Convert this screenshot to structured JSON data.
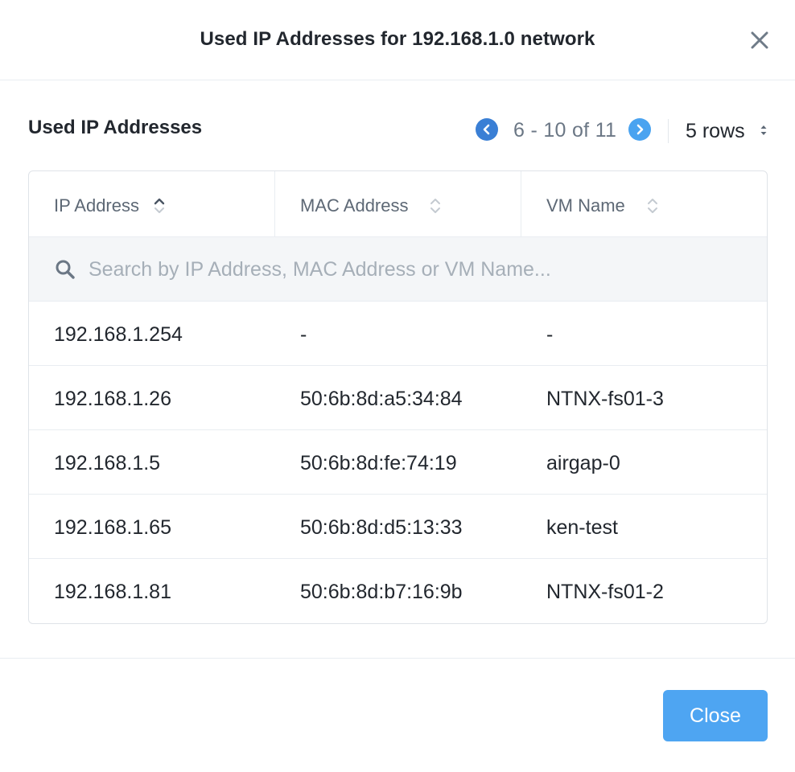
{
  "dialog": {
    "title": "Used IP Addresses for 192.168.1.0 network"
  },
  "section": {
    "title": "Used IP Addresses"
  },
  "pager": {
    "range": "6 - 10 of 11",
    "rows_label": "5 rows"
  },
  "table": {
    "columns": [
      "IP Address",
      "MAC Address",
      "VM Name"
    ],
    "sort": {
      "column": "IP Address",
      "direction": "ascending"
    },
    "search_placeholder": "Search by IP Address, MAC Address or VM Name...",
    "rows": [
      [
        "192.168.1.254",
        "-",
        "-"
      ],
      [
        "192.168.1.26",
        "50:6b:8d:a5:34:84",
        "NTNX-fs01-3"
      ],
      [
        "192.168.1.5",
        "50:6b:8d:fe:74:19",
        "airgap-0"
      ],
      [
        "192.168.1.65",
        "50:6b:8d:d5:13:33",
        "ken-test"
      ],
      [
        "192.168.1.81",
        "50:6b:8d:b7:16:9b",
        "NTNX-fs01-2"
      ]
    ]
  },
  "footer": {
    "close_label": "Close"
  },
  "colors": {
    "primary_button": "#4ea5f2",
    "pager_prev": "#3a7fd5",
    "pager_next": "#4aa3f0",
    "search_bg": "#f4f6f8"
  },
  "icons": {
    "close": "close-icon",
    "prev": "chevron-left-icon",
    "next": "chevron-right-icon",
    "rows_caret": "sort-caret-icon",
    "search": "search-icon",
    "sort": "sort-icon"
  }
}
